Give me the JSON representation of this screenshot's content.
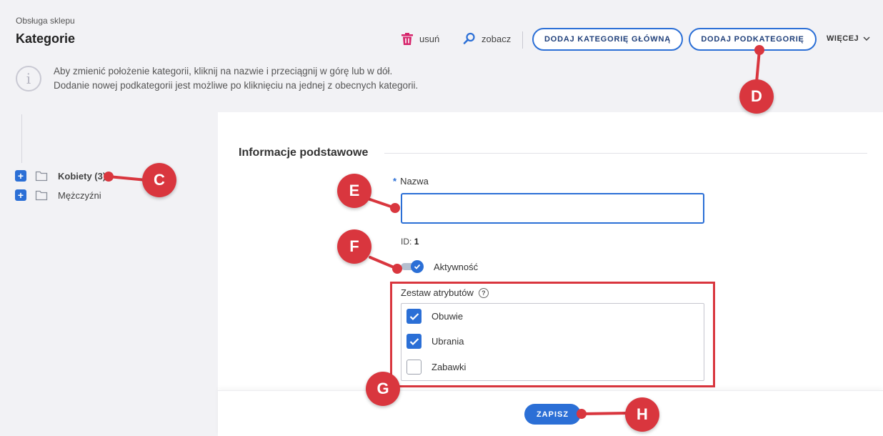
{
  "header": {
    "breadcrumb": "Obsługa sklepu",
    "title": "Kategorie"
  },
  "toolbar": {
    "delete_label": "usuń",
    "view_label": "zobacz",
    "add_main_category": "DODAJ KATEGORIĘ GŁÓWNĄ",
    "add_subcategory": "DODAJ PODKATEGORIĘ",
    "more_label": "WIĘCEJ"
  },
  "info": {
    "line1": "Aby zmienić położenie kategorii, kliknij na nazwie i przeciągnij w górę lub w dół.",
    "line2": "Dodanie nowej podkategorii jest możliwe po kliknięciu na jednej z obecnych kategorii."
  },
  "tree": {
    "items": [
      {
        "label": "Kobiety (3)",
        "bold": true
      },
      {
        "label": "Mężczyźni",
        "bold": false
      }
    ]
  },
  "form": {
    "section_title": "Informacje podstawowe",
    "required_mark": "*",
    "name_label": "Nazwa",
    "name_value": "",
    "id_label": "ID:",
    "id_value": "1",
    "active_label": "Aktywność",
    "active_on": true,
    "attribute_set_label": "Zestaw atrybutów",
    "attribute_sets": [
      {
        "label": "Obuwie",
        "checked": true
      },
      {
        "label": "Ubrania",
        "checked": true
      },
      {
        "label": "Zabawki",
        "checked": false
      }
    ],
    "save_label": "ZAPISZ"
  },
  "annotations": {
    "marker_color": "#d9363e",
    "labels": [
      "C",
      "D",
      "E",
      "F",
      "G",
      "H"
    ]
  },
  "colors": {
    "accent": "#2b6fd6",
    "delete": "#d6246b",
    "annotation": "#d9363e"
  }
}
